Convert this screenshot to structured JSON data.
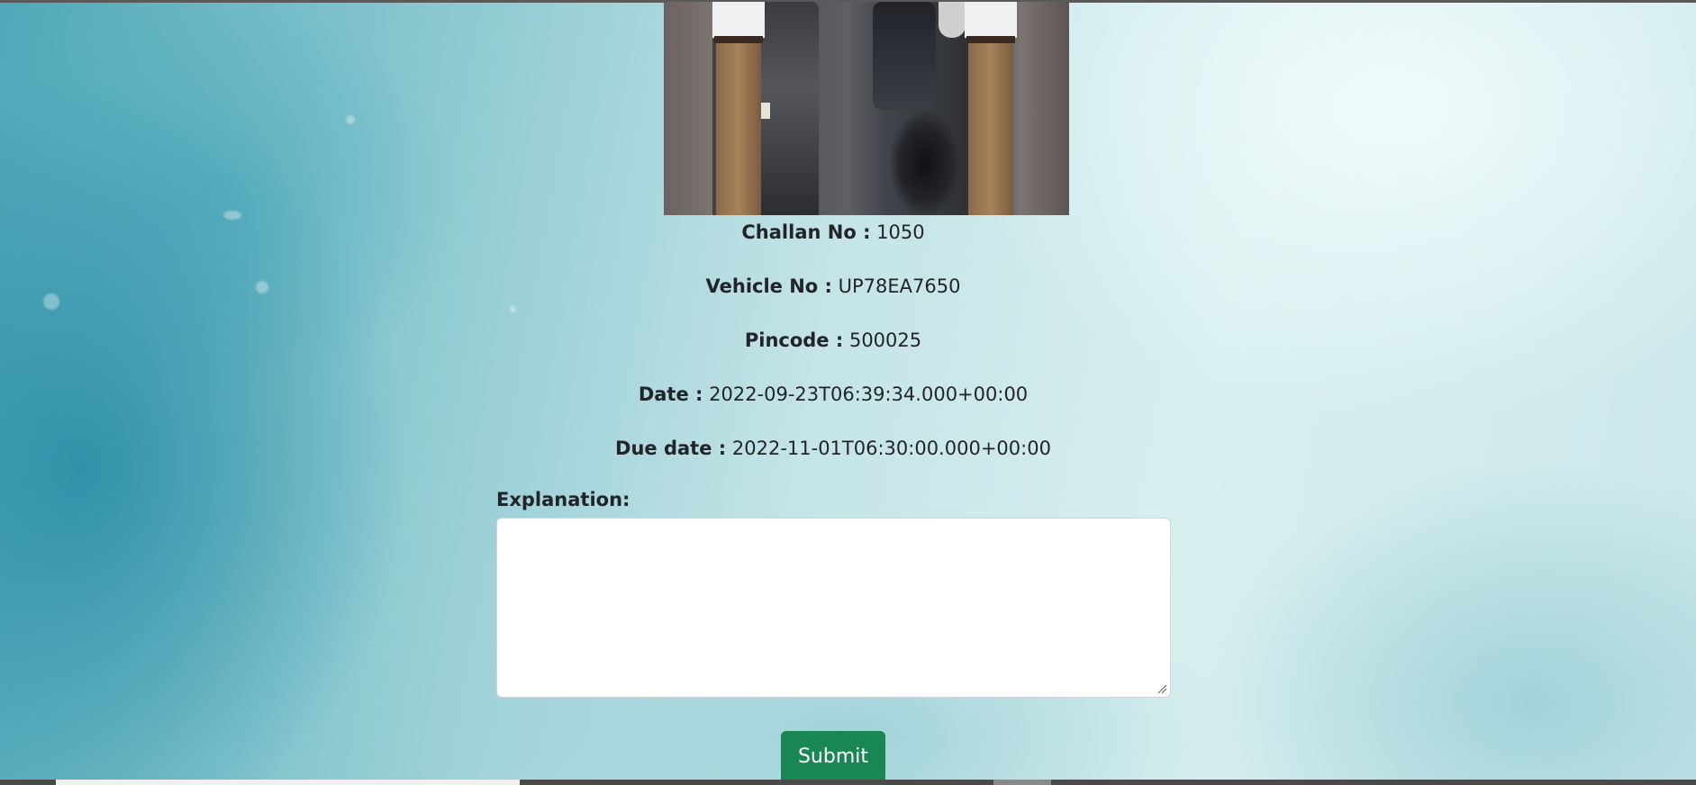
{
  "photo": {
    "alt": "traffic police officers standing on a road with vehicles"
  },
  "details": [
    {
      "label": "Challan No :",
      "value": "1050"
    },
    {
      "label": "Vehicle No :",
      "value": "UP78EA7650"
    },
    {
      "label": "Pincode :",
      "value": "500025"
    },
    {
      "label": "Date :",
      "value": "2022-09-23T06:39:34.000+00:00"
    },
    {
      "label": "Due date :",
      "value": "2022-11-01T06:30:00.000+00:00"
    }
  ],
  "form": {
    "explanation_label": "Explanation:",
    "explanation_value": "",
    "submit_label": "Submit"
  },
  "colors": {
    "submit_button": "#198754",
    "text": "#212529"
  }
}
